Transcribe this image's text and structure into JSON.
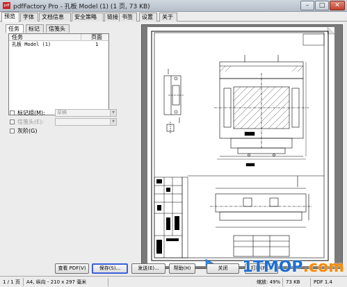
{
  "window": {
    "title": "pdfFactory Pro - 孔板 Model (1) (1 页, 73 KB)",
    "app_icon_text": "pdf",
    "min_glyph": "–",
    "max_glyph": "□",
    "close_glyph": "✕"
  },
  "tabs": [
    "预览",
    "字体",
    "文档信息",
    "安全策略",
    "链接",
    "书签",
    "设置",
    "关于"
  ],
  "subtabs": [
    "任务",
    "标记",
    "信笺头"
  ],
  "task_list": {
    "headers": {
      "task": "任务",
      "pages": "页面"
    },
    "rows": [
      {
        "task": "孔板 Model (1)",
        "pages": "1"
      }
    ]
  },
  "options": {
    "markgroup_label": "标记组(M):",
    "markgroup_value": "草稿",
    "letterhead_label": "信笺头(E):",
    "gray_label": "灰阶(G)"
  },
  "buttons": {
    "view_pdf": "查看 PDF(V)",
    "save": "保存(S)...",
    "send": "发送(E)...",
    "help": "帮助(H)",
    "close": "关闭",
    "print": "打印(P)..."
  },
  "status": {
    "pages": "1 / 1 页",
    "paper": "A4, 纵向 - 210 x 297 毫米",
    "zoom": "缩放: 49%",
    "size": "73 KB",
    "pdf_version": "PDF 1.4"
  },
  "watermark": {
    "main": "1TMOP",
    "suffix": ".com"
  }
}
